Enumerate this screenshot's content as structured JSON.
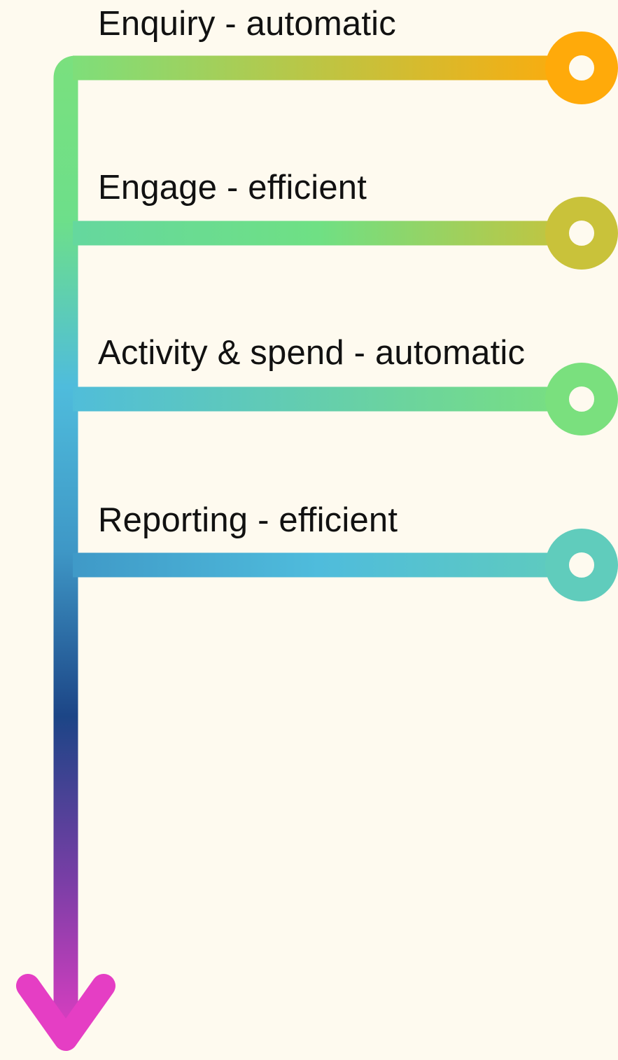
{
  "background_color": "#fefaef",
  "stem_gradient_colors": [
    "#7ae07e",
    "#6ddf8a",
    "#4fbcdc",
    "#3e97c6",
    "#1c4586",
    "#7a3ea6",
    "#e53ec4"
  ],
  "branches": [
    {
      "label": "Enquiry - automatic",
      "gradient_colors": [
        "#7ae07e",
        "#ffaa0a"
      ],
      "node_color": "#ffaa0a",
      "node_icon": "ring-node-icon"
    },
    {
      "label": "Engage - efficient",
      "gradient_colors": [
        "#64d7a0",
        "#6fe084",
        "#c9c23a"
      ],
      "node_color": "#c9c23a",
      "node_icon": "ring-node-icon"
    },
    {
      "label": "Activity & spend - automatic",
      "gradient_colors": [
        "#4fbcdc",
        "#7ae07e"
      ],
      "node_color": "#7ae07e",
      "node_icon": "ring-node-icon"
    },
    {
      "label": "Reporting - efficient",
      "gradient_colors": [
        "#3e97c6",
        "#4fbcdc",
        "#60ccbc"
      ],
      "node_color": "#60ccbc",
      "node_icon": "ring-node-icon"
    }
  ],
  "arrow": {
    "icon": "arrow-down-icon",
    "color": "#e53ec4"
  }
}
